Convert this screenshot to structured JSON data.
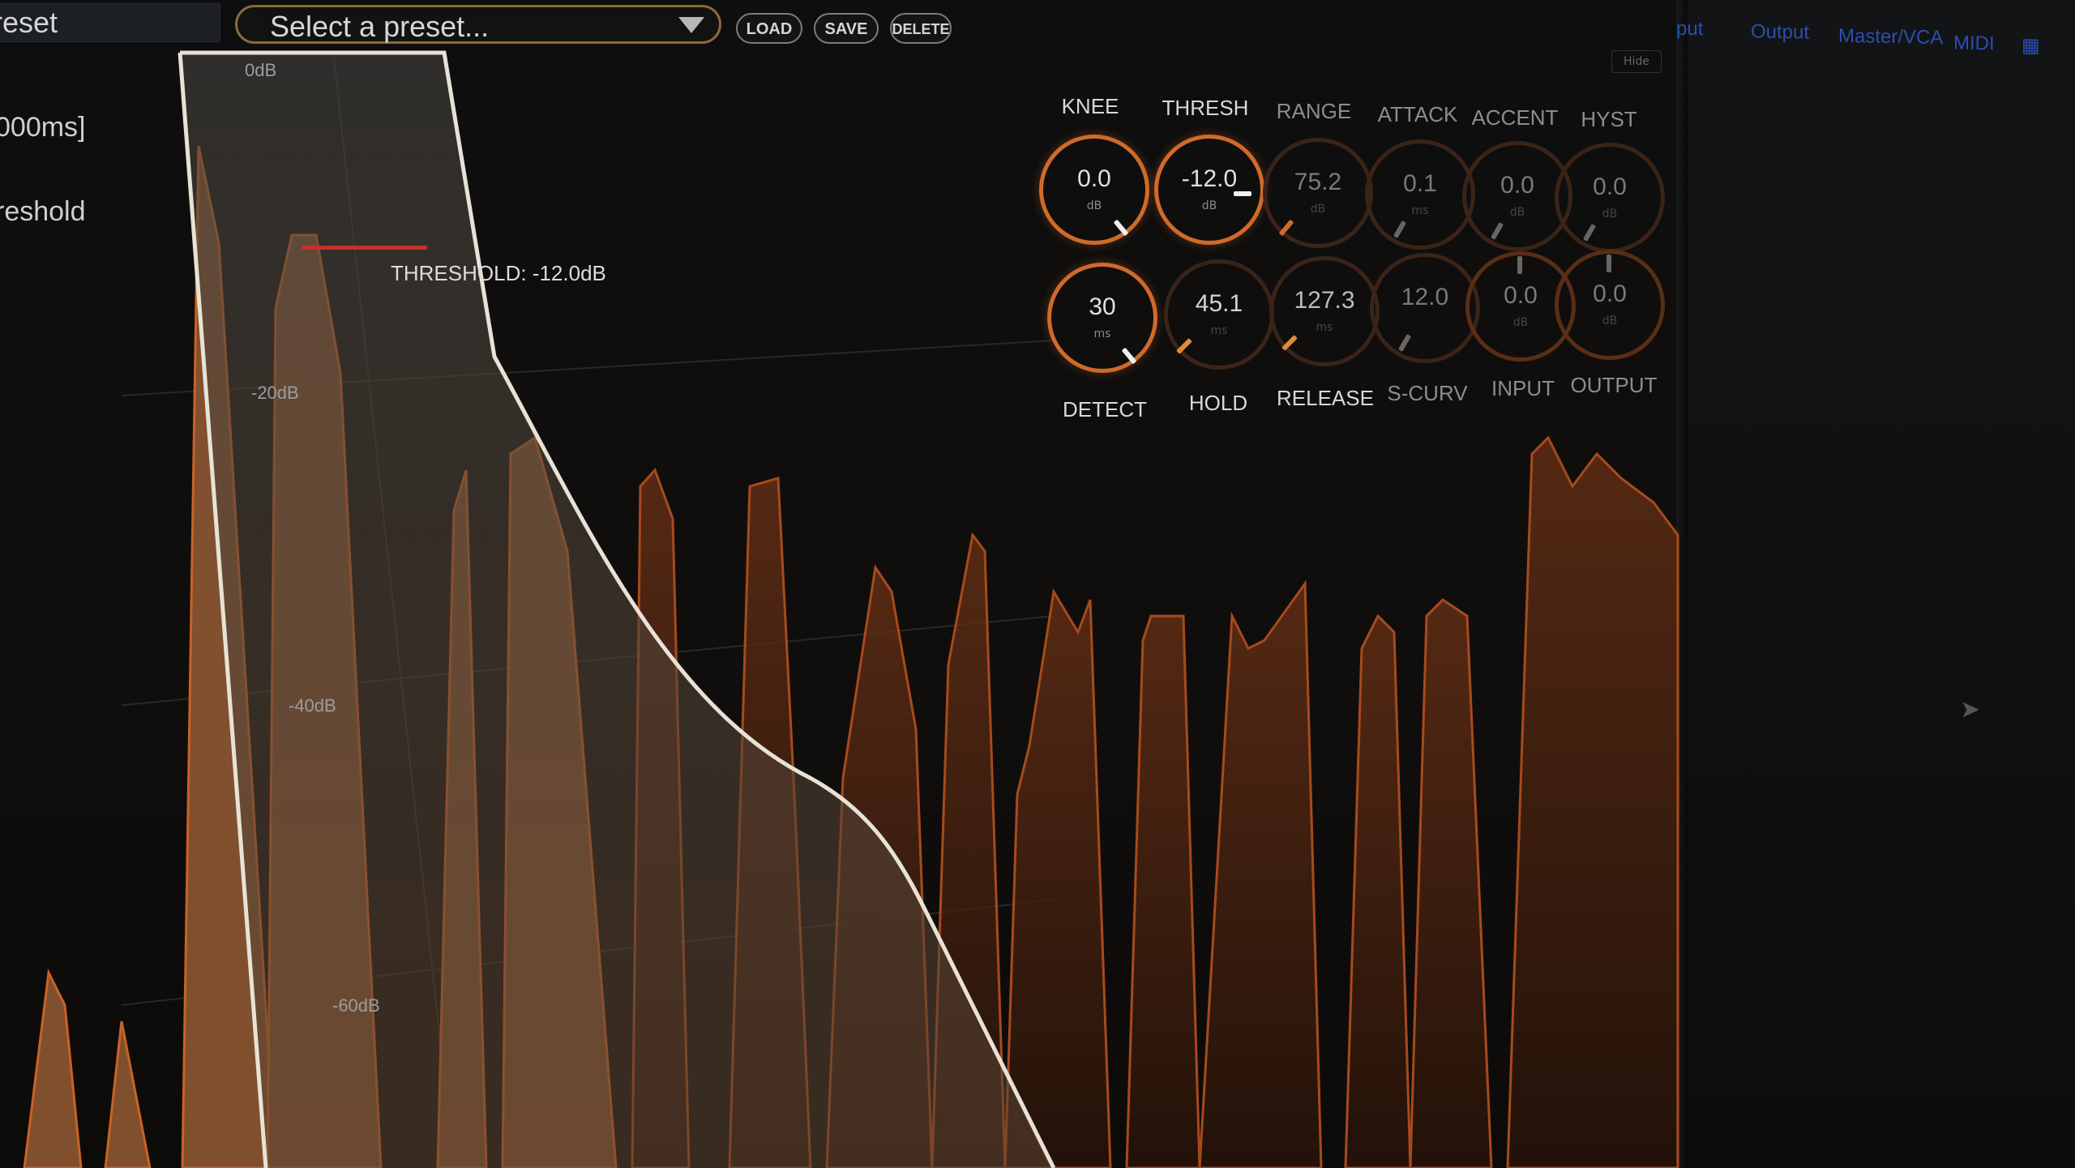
{
  "header": {
    "preset_label": "reset",
    "preset_placeholder": "Select a preset...",
    "load_label": "LOAD",
    "save_label": "SAVE",
    "delete_label": "DELETE"
  },
  "sidebar": {
    "line1": "000ms]",
    "line2": "reshold"
  },
  "right_panel": {
    "tabs": [
      "put",
      "Output",
      "Master/VCA",
      "MIDI"
    ],
    "hide_label": "Hide"
  },
  "graph": {
    "db_labels": [
      "0dB",
      "-20dB",
      "-40dB",
      "-60dB"
    ],
    "threshold_readout": "THRESHOLD: -12.0dB",
    "accent_color": "#d06a2a",
    "threshold_color": "#c7302a",
    "curve_color": "#e8e2d6"
  },
  "knobs": {
    "top": [
      {
        "label": "KNEE",
        "value": "0.0",
        "unit": "dB"
      },
      {
        "label": "THRESH",
        "value": "-12.0",
        "unit": "dB"
      },
      {
        "label": "RANGE",
        "value": "75.2",
        "unit": "dB"
      },
      {
        "label": "ATTACK",
        "value": "0.1",
        "unit": "ms"
      },
      {
        "label": "ACCENT",
        "value": "0.0",
        "unit": "dB"
      },
      {
        "label": "HYST",
        "value": "0.0",
        "unit": "dB"
      }
    ],
    "bottom": [
      {
        "label": "DETECT",
        "value": "30",
        "unit": "ms"
      },
      {
        "label": "HOLD",
        "value": "45.1",
        "unit": "ms"
      },
      {
        "label": "RELEASE",
        "value": "127.3",
        "unit": "ms"
      },
      {
        "label": "S-CURV",
        "value": "12.0",
        "unit": ""
      },
      {
        "label": "INPUT",
        "value": "0.0",
        "unit": "dB"
      },
      {
        "label": "OUTPUT",
        "value": "0.0",
        "unit": "dB"
      }
    ]
  }
}
